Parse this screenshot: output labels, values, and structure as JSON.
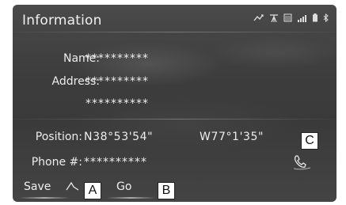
{
  "screen": {
    "title": "Information"
  },
  "status_icons": [
    "signal-arrows-icon",
    "tower-icon",
    "sd-card-icon",
    "signal-bars-icon",
    "battery-icon",
    "bluetooth-icon"
  ],
  "fields": {
    "name": {
      "label": "Name:",
      "value": "**********"
    },
    "address": {
      "label": "Address:",
      "value_line1": "**********",
      "value_line2": "**********"
    },
    "position": {
      "label": "Position:",
      "latitude": "N38°53'54\"",
      "longitude": "W77°1'35\""
    },
    "phone": {
      "label": "Phone #:",
      "value": "**********"
    }
  },
  "buttons": {
    "save_label": "Save",
    "go_label": "Go"
  },
  "callouts": {
    "a": "A",
    "b": "B",
    "c": "C"
  }
}
